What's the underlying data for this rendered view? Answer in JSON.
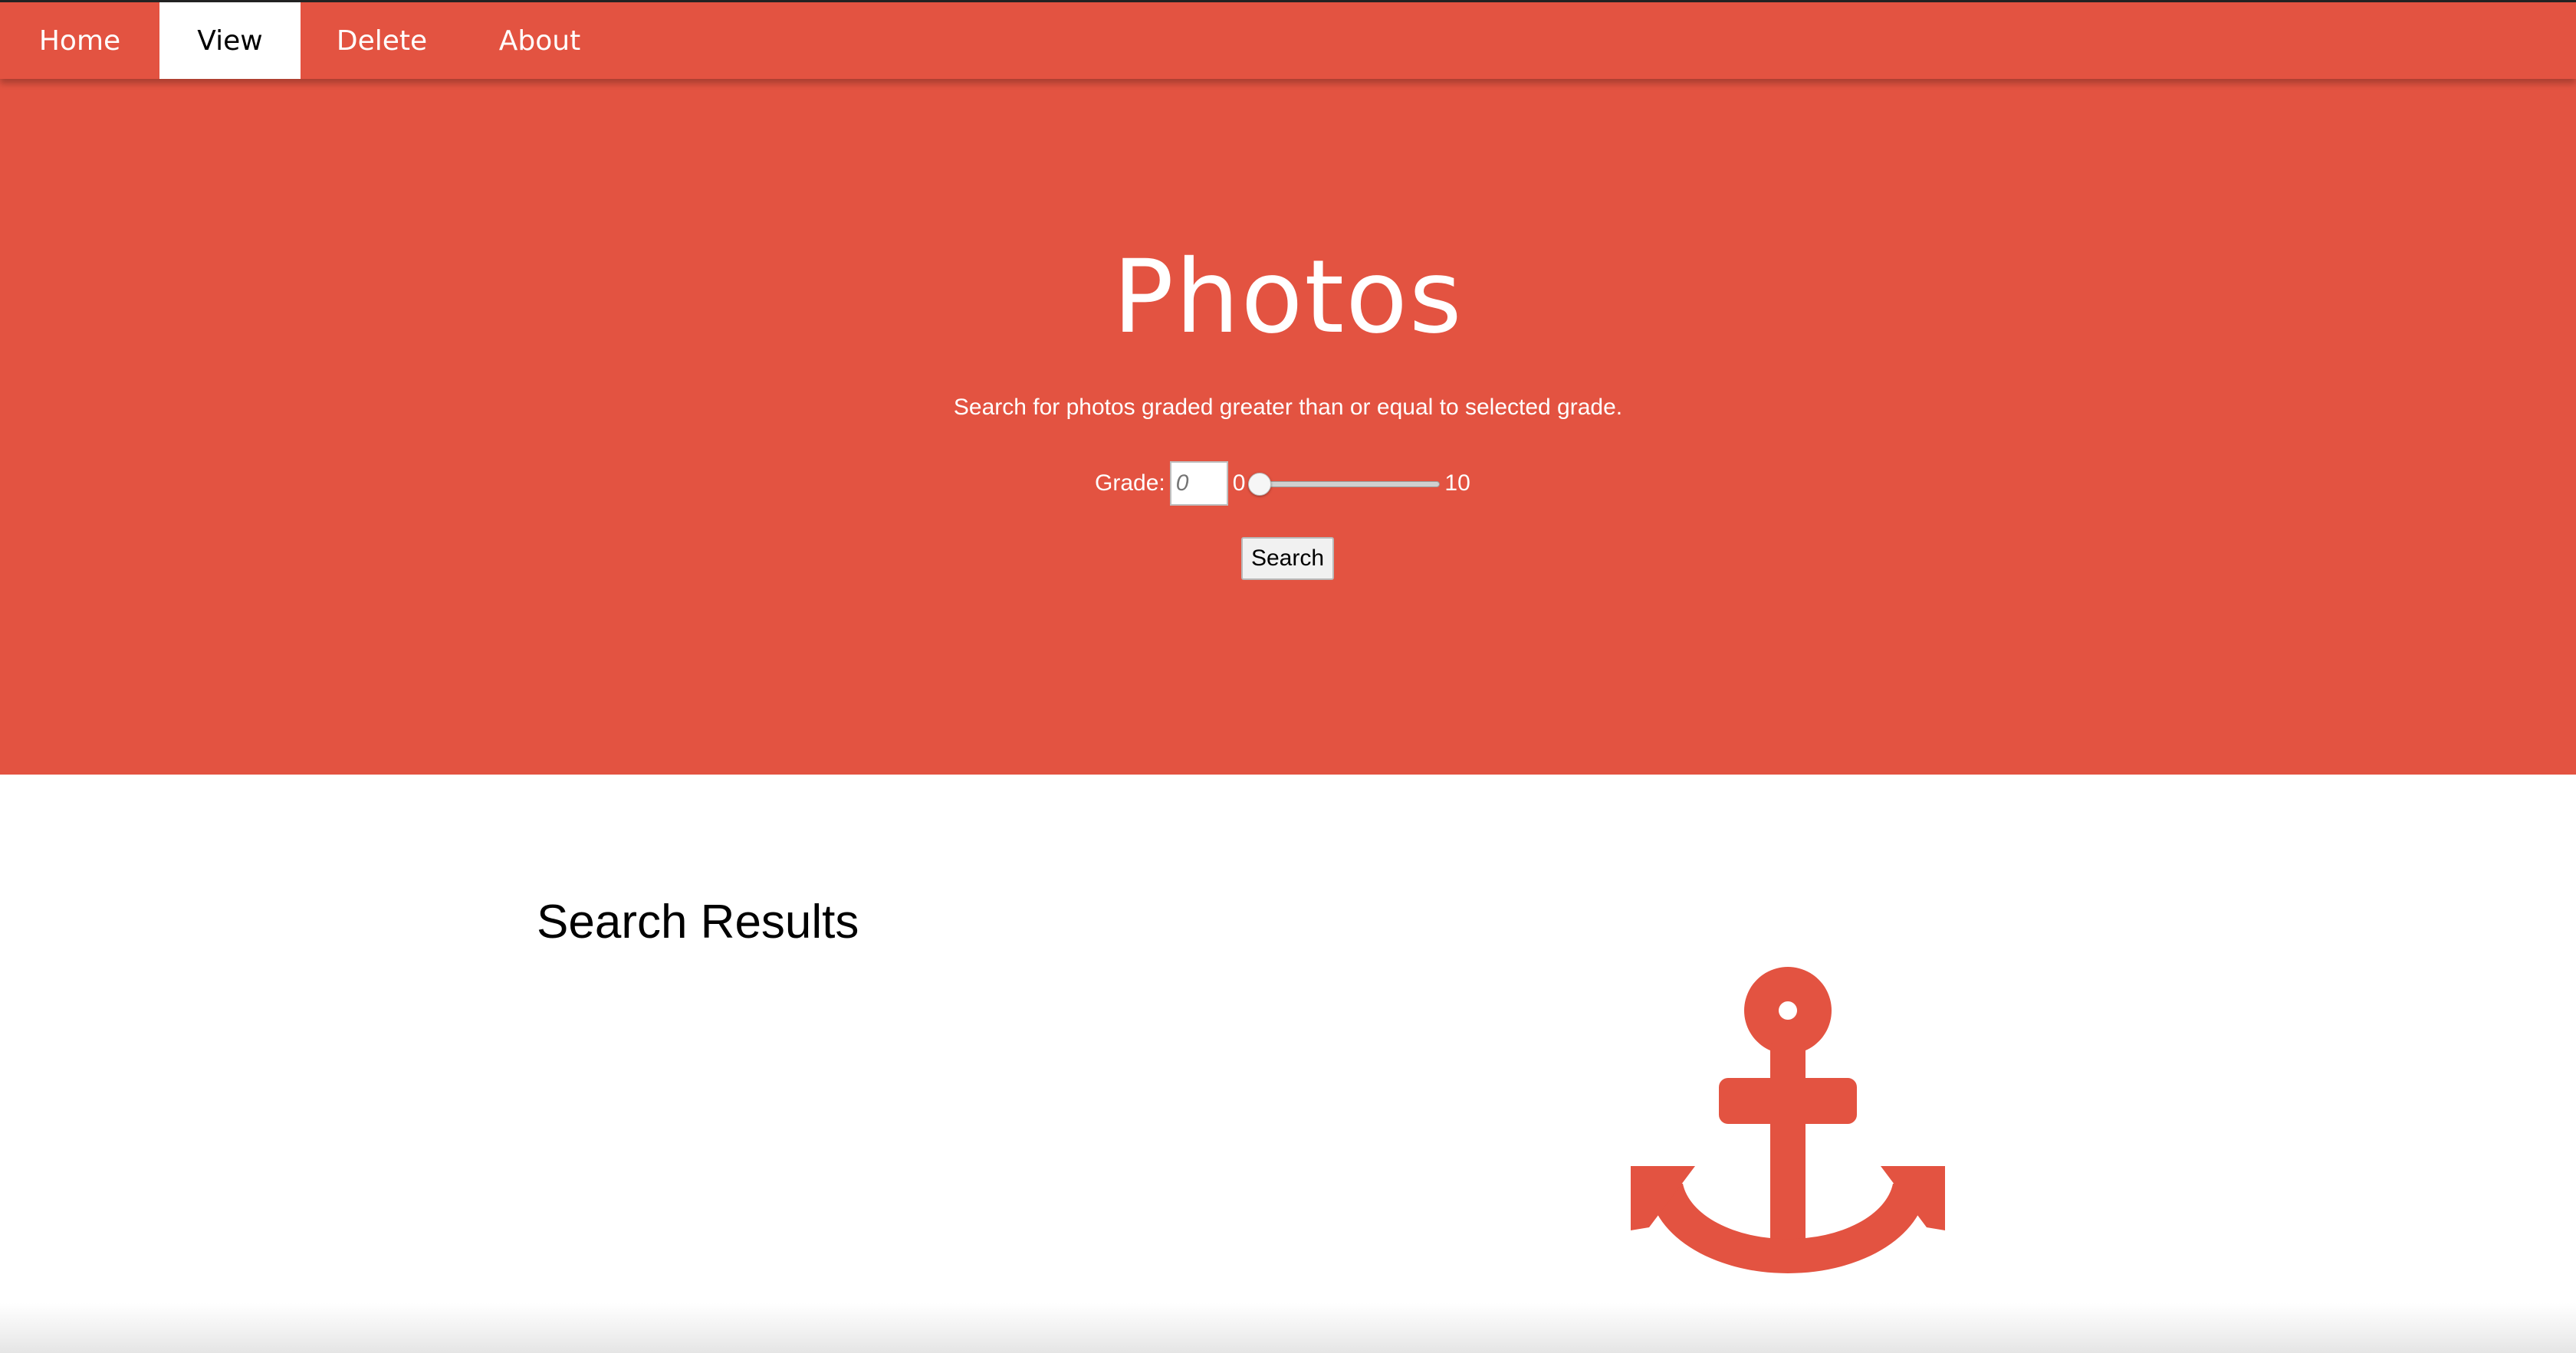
{
  "nav": {
    "items": [
      {
        "label": "Home",
        "active": false
      },
      {
        "label": "View",
        "active": true
      },
      {
        "label": "Delete",
        "active": false
      },
      {
        "label": "About",
        "active": false
      }
    ]
  },
  "hero": {
    "title": "Photos",
    "description": "Search for photos graded greater than or equal to selected grade.",
    "grade_label": "Grade:",
    "grade_placeholder": "0",
    "range_min": "0",
    "range_max": "10",
    "slider_value": 0,
    "search_label": "Search"
  },
  "results": {
    "title": "Search Results",
    "icon": "anchor-icon"
  },
  "colors": {
    "accent": "#e35341",
    "text_on_accent": "#ffffff"
  }
}
